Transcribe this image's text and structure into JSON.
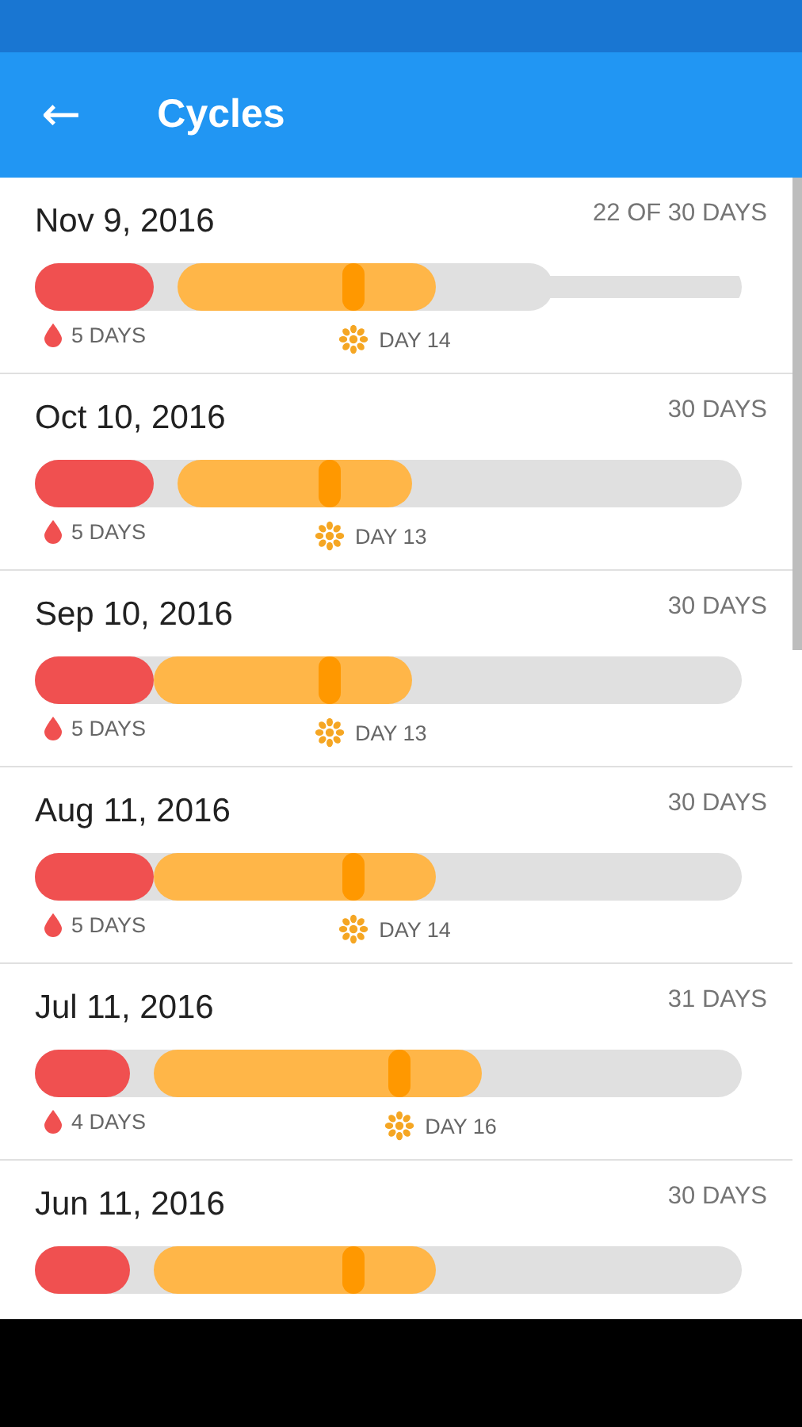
{
  "app_bar": {
    "back_icon": "←",
    "title": "Cycles"
  },
  "cycles": [
    {
      "date": "Nov 9, 2016",
      "length": "22 OF 30 DAYS",
      "elapsed": {
        "level": 0.733
      },
      "period": {
        "level": 0.168
      },
      "gap": true,
      "ovulation": {
        "level": 0.451
      },
      "legend": {
        "period": "5 DAYS",
        "ovulation": "DAY 14"
      }
    },
    {
      "date": "Oct 10, 2016",
      "length": "30 DAYS",
      "period": {
        "level": 0.168
      },
      "gap": true,
      "ovulation": {
        "level": 0.417
      },
      "legend": {
        "period": "5 DAYS",
        "ovulation": "DAY 13"
      }
    },
    {
      "date": "Sep 10, 2016",
      "length": "30 DAYS",
      "period": {
        "level": 0.168
      },
      "gap": false,
      "ovulation": {
        "level": 0.417
      },
      "legend": {
        "period": "5 DAYS",
        "ovulation": "DAY 13"
      }
    },
    {
      "date": "Aug 11, 2016",
      "length": "30 DAYS",
      "period": {
        "level": 0.168
      },
      "gap": false,
      "ovulation": {
        "level": 0.451
      },
      "legend": {
        "period": "5 DAYS",
        "ovulation": "DAY 14"
      }
    },
    {
      "date": "Jul 11, 2016",
      "length": "31 DAYS",
      "period": {
        "level": 0.135
      },
      "gap": true,
      "ovulation": {
        "level": 0.516
      },
      "legend": {
        "period": "4 DAYS",
        "ovulation": "DAY 16"
      }
    },
    {
      "date": "Jun 11, 2016",
      "length": "30 DAYS",
      "period": {
        "level": 0.135
      },
      "gap": true,
      "ovulation": {
        "level": 0.451
      }
    }
  ]
}
